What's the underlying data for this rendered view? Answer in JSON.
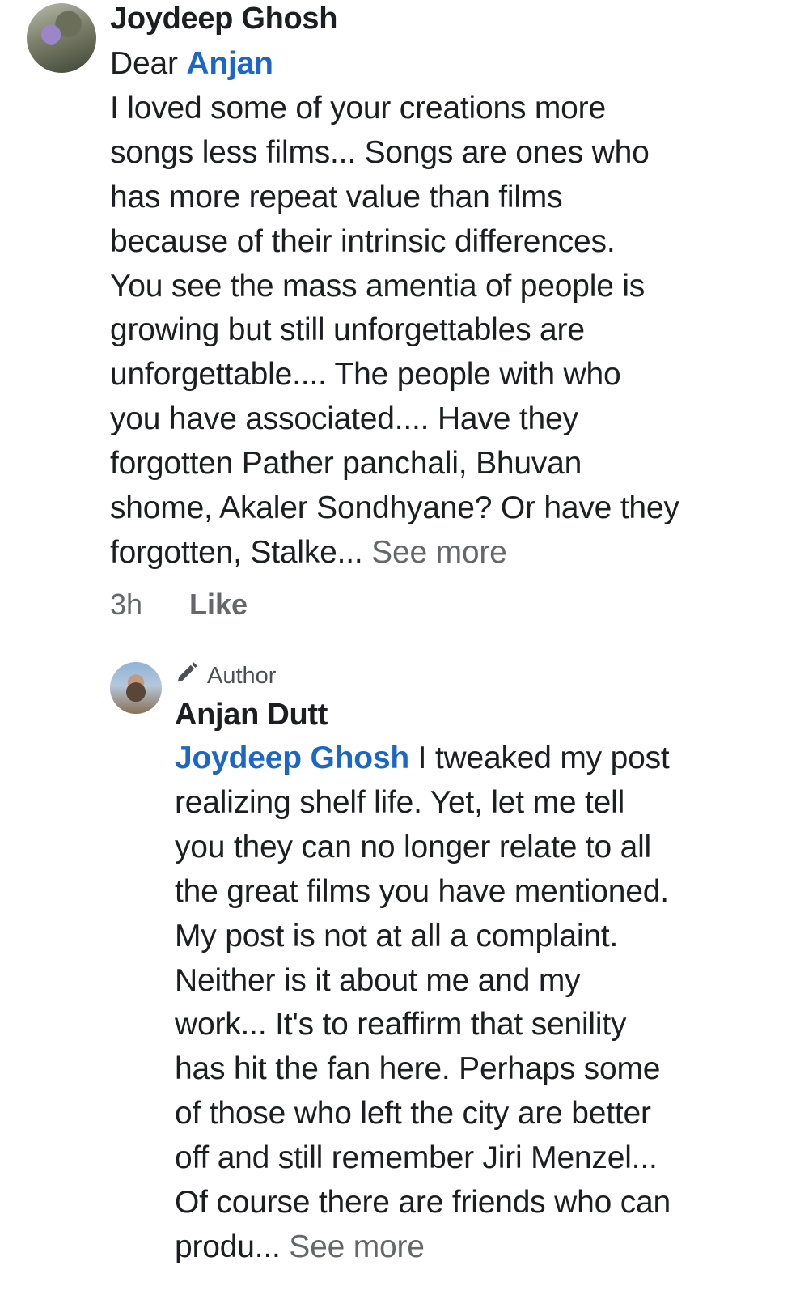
{
  "comments": [
    {
      "author": "Joydeep Ghosh",
      "salutation": "Dear",
      "mention": "Anjan",
      "lines": [
        "I loved some of your creations more",
        "songs less films... Songs are ones who",
        "has more repeat value than films",
        "because of their intrinsic differences.",
        "You see the mass amentia of people is",
        "growing but still unforgettables  are",
        "unforgettable.... The people with who",
        "you have associated.... Have they",
        "forgotten  Pather panchali, Bhuvan",
        "shome, Akaler Sondhyane?  Or have they",
        "forgotten, Stalke..."
      ],
      "see_more": "See more",
      "time": "3h",
      "like_label": "Like",
      "avatar_icon": "user-avatar-photo"
    },
    {
      "badge_icon": "pencil-icon",
      "badge": "Author",
      "author": "Anjan Dutt",
      "mention": "Joydeep Ghosh",
      "first_line_rest": " I tweaked my post",
      "lines": [
        "realizing shelf life. Yet, let me tell",
        "you they can no longer relate to all",
        "the great films you have mentioned.",
        "My post is not at all a complaint.",
        "Neither is it about me and my",
        "work... It's to reaffirm that senility",
        "has hit the fan here. Perhaps some",
        "of those who left the city are better",
        "off and still remember Jiri Menzel...",
        "Of course there are friends who can",
        "produ..."
      ],
      "see_more": "See more",
      "avatar_icon": "user-avatar-photo"
    }
  ],
  "colors": {
    "text": "#1c1e21",
    "mention": "#1b66c9",
    "secondary": "#65676b"
  }
}
